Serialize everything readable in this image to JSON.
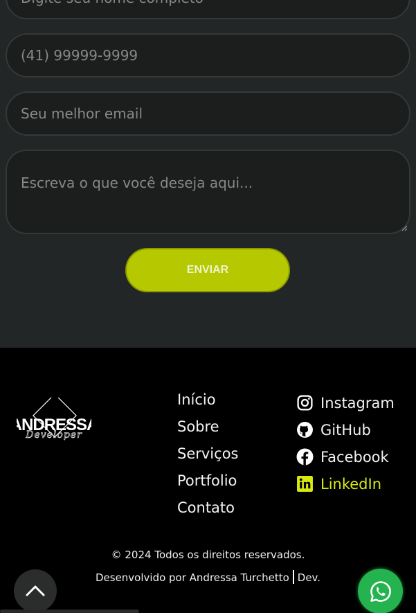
{
  "form": {
    "name_placeholder": "Digite seu nome completo",
    "phone_placeholder": "(41) 99999-9999",
    "email_placeholder": "Seu melhor email",
    "message_placeholder": "Escreva o que você deseja aqui...",
    "submit_label": "ENVIAR"
  },
  "footer": {
    "logo": {
      "name": "ANDRESSA",
      "subtitle": "Developer"
    },
    "nav": [
      "Início",
      "Sobre",
      "Serviços",
      "Portfolio",
      "Contato"
    ],
    "social": [
      {
        "label": "Instagram",
        "icon": "instagram-icon"
      },
      {
        "label": "GitHub",
        "icon": "github-icon"
      },
      {
        "label": "Facebook",
        "icon": "facebook-icon"
      },
      {
        "label": "LinkedIn",
        "icon": "linkedin-icon"
      }
    ],
    "copyright": "© 2024 Todos os direitos reservados.",
    "credit_text": "Desenvolvido por Andressa Turchetto",
    "credit_role": "Dev."
  },
  "colors": {
    "accent": "#b5c800",
    "linkedin_accent": "#d6ea12",
    "whatsapp": "#25b34f",
    "form_bg": "#232626"
  },
  "floating": {
    "back_to_top_icon": "chevron-up-icon",
    "whatsapp_icon": "whatsapp-icon"
  }
}
